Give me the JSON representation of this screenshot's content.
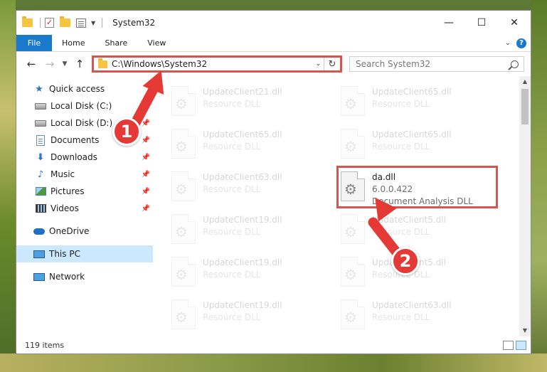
{
  "window": {
    "title": "System32"
  },
  "ribbon": {
    "tabs": [
      "File",
      "Home",
      "Share",
      "View"
    ],
    "help": "?"
  },
  "address": {
    "path": "C:\\Windows\\System32"
  },
  "search": {
    "placeholder": "Search System32"
  },
  "sidebar": {
    "quick_access": "Quick access",
    "items": [
      {
        "label": "Local Disk (C:)",
        "icon": "drive-icon",
        "pinned": true
      },
      {
        "label": "Local Disk (D:)",
        "icon": "drive-icon",
        "pinned": true
      },
      {
        "label": "Documents",
        "icon": "documents-icon",
        "pinned": true
      },
      {
        "label": "Downloads",
        "icon": "downloads-icon",
        "pinned": true
      },
      {
        "label": "Music",
        "icon": "music-icon",
        "pinned": true
      },
      {
        "label": "Pictures",
        "icon": "pictures-icon",
        "pinned": true
      },
      {
        "label": "Videos",
        "icon": "videos-icon",
        "pinned": true
      }
    ],
    "onedrive": "OneDrive",
    "this_pc": "This PC",
    "network": "Network"
  },
  "files": [
    {
      "name": "UpdateClient21.dll",
      "sub": "Resource DLL",
      "faded": true
    },
    {
      "name": "UpdateClient65.dll",
      "sub": "Resource DLL",
      "faded": true
    },
    {
      "name": "UpdateClient65.dll",
      "sub": "Resource DLL",
      "faded": true
    },
    {
      "name": "UpdateClient65.dll",
      "sub": "Resource DLL",
      "faded": true
    },
    {
      "name": "UpdateClient63.dll",
      "sub": "Resource DLL",
      "faded": true
    },
    {
      "name": "da.dll",
      "version": "6.0.0.422",
      "sub": "Document Analysis DLL",
      "faded": false
    },
    {
      "name": "UpdateClient19.dll",
      "sub": "Resource DLL",
      "faded": true
    },
    {
      "name": "UpdateClient5.dll",
      "sub": "Resource DLL",
      "faded": true
    },
    {
      "name": "UpdateClient19.dll",
      "sub": "Resource DLL",
      "faded": true
    },
    {
      "name": "UpdateClient5.dll",
      "sub": "Resource DLL",
      "faded": true
    },
    {
      "name": "UpdateClient19.dll",
      "sub": "Resource DLL",
      "faded": true
    },
    {
      "name": "UpdateClient63.dll",
      "sub": "Resource DLL",
      "faded": true
    }
  ],
  "status": {
    "items_count": "119 items"
  },
  "annotations": {
    "badge1": "1",
    "badge2": "2",
    "color": "#e53935"
  }
}
